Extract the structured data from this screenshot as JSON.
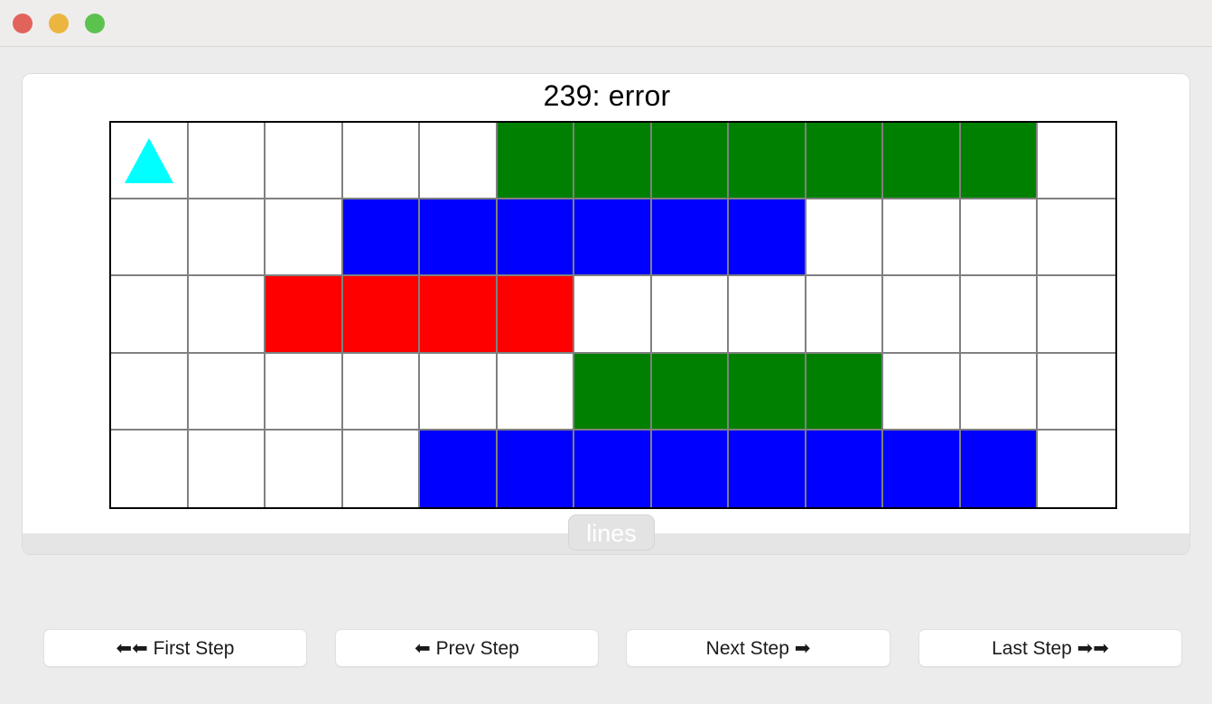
{
  "window": {
    "traffic_lights": [
      {
        "name": "close",
        "color": "#e1635c"
      },
      {
        "name": "minimize",
        "color": "#ecb53f"
      },
      {
        "name": "zoom",
        "color": "#5cc24e"
      }
    ]
  },
  "chart_data": {
    "type": "heatmap",
    "title": "239: error",
    "rows": 5,
    "cols": 13,
    "xlabel": "",
    "ylabel": "",
    "grid": true,
    "legend_position": "bottom-center",
    "legend": [
      {
        "label": "lines",
        "color": "#ffffff"
      }
    ],
    "colors": {
      "empty": "#ffffff",
      "green": "#008000",
      "blue": "#0000ff",
      "red": "#ff0000",
      "marker": "#00ffff",
      "gridline": "#808080",
      "border": "#000000"
    },
    "cells": [
      [
        "white",
        "white",
        "white",
        "white",
        "white",
        "green",
        "green",
        "green",
        "green",
        "green",
        "green",
        "green",
        "white"
      ],
      [
        "white",
        "white",
        "white",
        "blue",
        "blue",
        "blue",
        "blue",
        "blue",
        "blue",
        "white",
        "white",
        "white",
        "white"
      ],
      [
        "white",
        "white",
        "red",
        "red",
        "red",
        "red",
        "white",
        "white",
        "white",
        "white",
        "white",
        "white",
        "white"
      ],
      [
        "white",
        "white",
        "white",
        "white",
        "white",
        "white",
        "green",
        "green",
        "green",
        "green",
        "white",
        "white",
        "white"
      ],
      [
        "white",
        "white",
        "white",
        "white",
        "blue",
        "blue",
        "blue",
        "blue",
        "blue",
        "blue",
        "blue",
        "blue",
        "white"
      ]
    ],
    "markers": [
      {
        "row": 0,
        "col": 0,
        "shape": "triangle-up",
        "color": "#00ffff"
      }
    ],
    "series": [
      {
        "name": "green-run-row-1",
        "row": 1,
        "start_col": 6,
        "end_col": 12,
        "length": 7,
        "color": "#008000"
      },
      {
        "name": "blue-run-row-2",
        "row": 2,
        "start_col": 4,
        "end_col": 9,
        "length": 6,
        "color": "#0000ff"
      },
      {
        "name": "red-run-row-3",
        "row": 3,
        "start_col": 3,
        "end_col": 6,
        "length": 4,
        "color": "#ff0000"
      },
      {
        "name": "green-run-row-4",
        "row": 4,
        "start_col": 7,
        "end_col": 10,
        "length": 4,
        "color": "#008000"
      },
      {
        "name": "blue-run-row-5",
        "row": 5,
        "start_col": 5,
        "end_col": 12,
        "length": 8,
        "color": "#0000ff"
      }
    ]
  },
  "legend": {
    "label": "lines"
  },
  "controls": {
    "first_step": "⬅⬅ First Step",
    "prev_step": "⬅ Prev Step",
    "next_step": "Next Step ➡",
    "last_step": "Last Step ➡➡"
  }
}
